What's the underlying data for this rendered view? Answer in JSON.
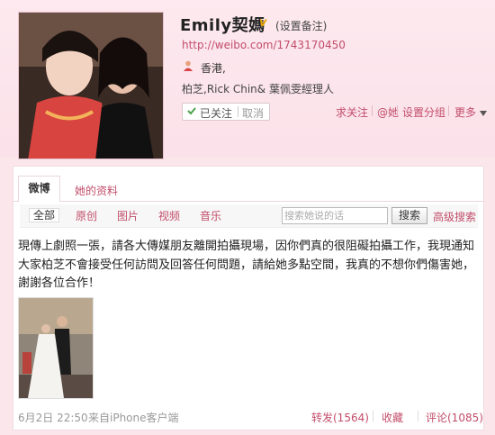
{
  "profile": {
    "name": "Emily契媽",
    "verified_badge": "v",
    "remark": "(设置备注)",
    "url": "http://weibo.com/1743170450",
    "location": "香港,",
    "bio": "柏芝,Rick Chin& 葉佩雯經理人",
    "followed_label": "已关注",
    "cancel_label": "取消"
  },
  "actions": {
    "unfollow": "求关注",
    "mention": "@她",
    "group": "设置分组",
    "more": "更多"
  },
  "tabs": [
    {
      "label": "微博"
    },
    {
      "label": "她的资料"
    }
  ],
  "filters": [
    {
      "label": "全部"
    },
    {
      "label": "原创"
    },
    {
      "label": "图片"
    },
    {
      "label": "视频"
    },
    {
      "label": "音乐"
    }
  ],
  "search": {
    "placeholder": "搜索她说的话",
    "button": "搜索",
    "advanced": "高级搜索"
  },
  "post": {
    "text": "現傳上劇照一張，請各大傳媒朋友離開拍攝現場，因你們真的很阻礙拍攝工作，我現通知大家柏芝不會接受任何訪問及回答任何問題，請給她多點空間，我真的不想你們傷害她，謝謝各位合作！",
    "date": "6月2日 22:50",
    "source": "来自iPhone客户端",
    "repost": "转发(1564)",
    "favorite": "收藏",
    "comment": "评论(1085)"
  },
  "colors": {
    "link": "#c24d6a",
    "background": "#fbe6ec"
  }
}
